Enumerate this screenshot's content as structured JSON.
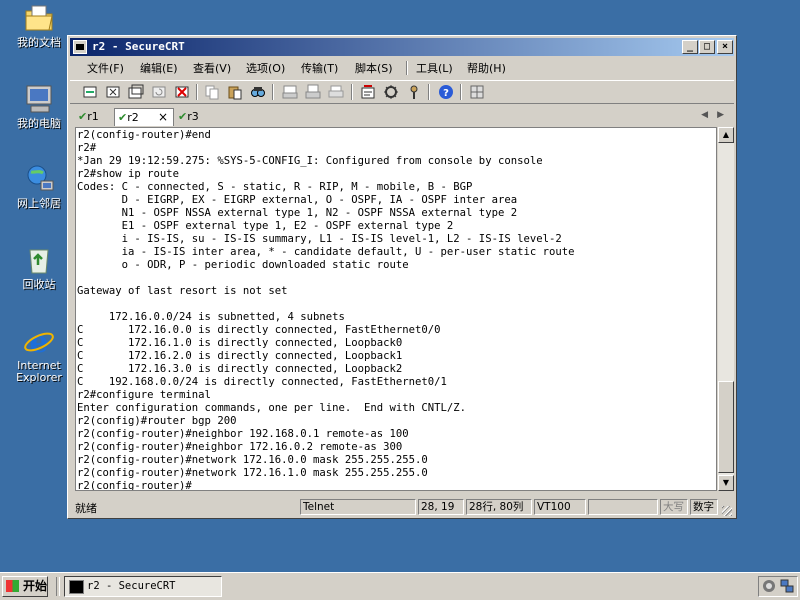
{
  "desktop": {
    "icons": [
      {
        "label": "我的文档",
        "icon": "my-documents-icon"
      },
      {
        "label": "我的电脑",
        "icon": "my-computer-icon"
      },
      {
        "label": "网上邻居",
        "icon": "network-places-icon"
      },
      {
        "label": "回收站",
        "icon": "recycle-bin-icon"
      },
      {
        "label": "Internet Explorer",
        "icon": "internet-explorer-icon"
      }
    ]
  },
  "window": {
    "title": "r2 - SecureCRT",
    "controls": {
      "minimize": "_",
      "maximize": "□",
      "close": "×"
    },
    "menu": [
      "文件(F)",
      "编辑(E)",
      "查看(V)",
      "选项(O)",
      "传输(T)",
      "脚本(S)",
      "工具(L)",
      "帮助(H)"
    ],
    "tabs": [
      {
        "label": "r1",
        "active": false
      },
      {
        "label": "r2",
        "active": true
      },
      {
        "label": "r3",
        "active": false
      }
    ],
    "tab_close": "×",
    "terminal_text": "r2(config-router)#end\nr2#\n*Jan 29 19:12:59.275: %SYS-5-CONFIG_I: Configured from console by console\nr2#show ip route\nCodes: C - connected, S - static, R - RIP, M - mobile, B - BGP\n       D - EIGRP, EX - EIGRP external, O - OSPF, IA - OSPF inter area\n       N1 - OSPF NSSA external type 1, N2 - OSPF NSSA external type 2\n       E1 - OSPF external type 1, E2 - OSPF external type 2\n       i - IS-IS, su - IS-IS summary, L1 - IS-IS level-1, L2 - IS-IS level-2\n       ia - IS-IS inter area, * - candidate default, U - per-user static route\n       o - ODR, P - periodic downloaded static route\n\nGateway of last resort is not set\n\n     172.16.0.0/24 is subnetted, 4 subnets\nC       172.16.0.0 is directly connected, FastEthernet0/0\nC       172.16.1.0 is directly connected, Loopback0\nC       172.16.2.0 is directly connected, Loopback1\nC       172.16.3.0 is directly connected, Loopback2\nC    192.168.0.0/24 is directly connected, FastEthernet0/1\nr2#configure terminal\nEnter configuration commands, one per line.  End with CNTL/Z.\nr2(config)#router bgp 200\nr2(config-router)#neighbor 192.168.0.1 remote-as 100\nr2(config-router)#neighbor 172.16.0.2 remote-as 300\nr2(config-router)#network 172.16.0.0 mask 255.255.255.0\nr2(config-router)#network 172.16.1.0 mask 255.255.255.0\nr2(config-router)#",
    "status": {
      "ready": "就绪",
      "protocol": "Telnet",
      "cursor": "28, 19",
      "size": "28行, 80列",
      "emulation": "VT100",
      "caps": "大写",
      "num": "数字"
    }
  },
  "taskbar": {
    "start_label": "开始",
    "task_label": "r2 - SecureCRT"
  },
  "colors": {
    "desktop": "#3a6ea5",
    "title_active_start": "#0a246a",
    "title_active_end": "#a6caf0",
    "chrome": "#d4d0c8"
  }
}
